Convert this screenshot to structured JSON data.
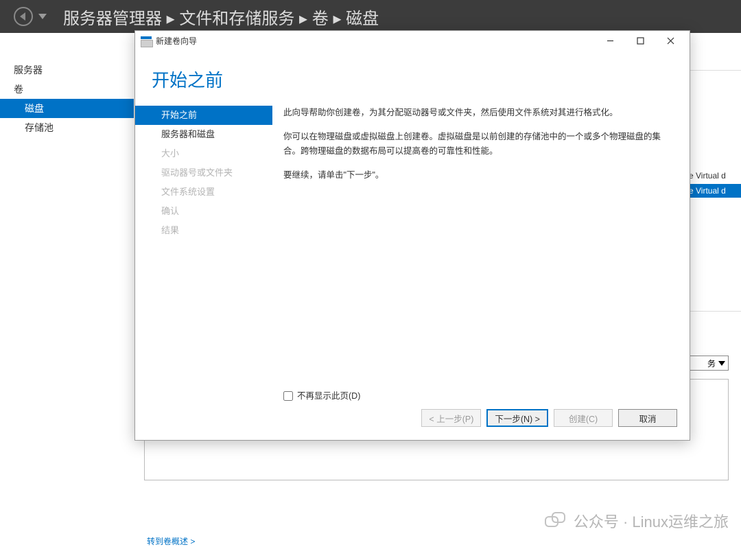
{
  "topbar": {
    "crumb1": "服务器管理器",
    "crumb2": "文件和存储服务",
    "crumb3": "卷",
    "crumb4": "磁盘",
    "sep": " ▸ "
  },
  "sidebar": {
    "items": [
      {
        "label": "服务器",
        "level": 1,
        "selected": false
      },
      {
        "label": "卷",
        "level": 1,
        "selected": false
      },
      {
        "label": "磁盘",
        "level": 2,
        "selected": true
      },
      {
        "label": "存储池",
        "level": 2,
        "selected": false
      }
    ]
  },
  "peek": {
    "row1": "e Virtual d",
    "row2": "e Virtual d",
    "tasks_label": "务",
    "bottom_link": "转到卷概述 >"
  },
  "wizard": {
    "window_title": "新建卷向导",
    "page_title": "开始之前",
    "steps": [
      {
        "label": "开始之前",
        "state": "current"
      },
      {
        "label": "服务器和磁盘",
        "state": "enabled"
      },
      {
        "label": "大小",
        "state": "disabled"
      },
      {
        "label": "驱动器号或文件夹",
        "state": "disabled"
      },
      {
        "label": "文件系统设置",
        "state": "disabled"
      },
      {
        "label": "确认",
        "state": "disabled"
      },
      {
        "label": "结果",
        "state": "disabled"
      }
    ],
    "para1": "此向导帮助你创建卷，为其分配驱动器号或文件夹，然后使用文件系统对其进行格式化。",
    "para2": "你可以在物理磁盘或虚拟磁盘上创建卷。虚拟磁盘是以前创建的存储池中的一个或多个物理磁盘的集合。跨物理磁盘的数据布局可以提高卷的可靠性和性能。",
    "para3": "要继续，请单击\"下一步\"。",
    "no_show_label": "不再显示此页(D)",
    "buttons": {
      "prev": "< 上一步(P)",
      "next": "下一步(N) >",
      "create": "创建(C)",
      "cancel": "取消"
    }
  },
  "watermark": {
    "text": "公众号 · Linux运维之旅"
  }
}
